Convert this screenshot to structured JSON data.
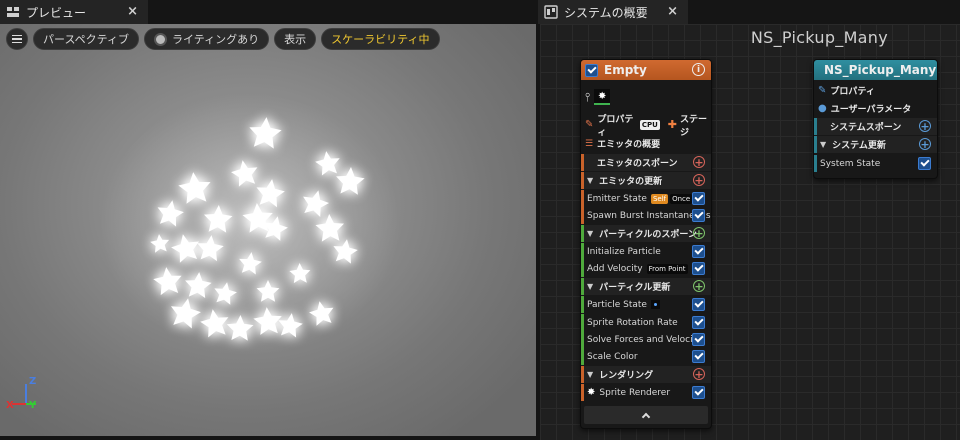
{
  "preview": {
    "tab_label": "プレビュー",
    "tab_close": "×",
    "toolbar": {
      "menu_icon": "hamburger-icon",
      "perspective_label": "パースペクティブ",
      "lighting_label": "ライティングあり",
      "show_label": "表示",
      "scalability_label": "スケーラビリティ中"
    },
    "axis": {
      "z": "Z",
      "x": "X",
      "y": "Y"
    }
  },
  "graph": {
    "tab_label": "システムの概要",
    "tab_close": "×",
    "title": "NS_Pickup_Many",
    "emitter_node": {
      "name": "Empty",
      "info_icon": "info-icon",
      "properties_label": "プロパティ",
      "cpu_label": "CPU",
      "stage_label": "ステージ",
      "emitter_summary_label": "エミッタの概要",
      "emitter_spawn_label": "エミッタのスポーン",
      "emitter_update_label": "エミッタの更新",
      "emitter_state_label": "Emitter State",
      "self_badge": "Self",
      "once_badge": "Once",
      "spawn_burst_label": "Spawn Burst Instantaneous",
      "particle_spawn_label": "パーティクルのスポーン",
      "initialize_particle_label": "Initialize Particle",
      "add_velocity_label": "Add Velocity",
      "from_point_badge": "From Point",
      "particle_update_label": "パーティクル更新",
      "particle_state_label": "Particle State",
      "sprite_rotation_label": "Sprite Rotation Rate",
      "solve_forces_label": "Solve Forces and Velocity",
      "scale_color_label": "Scale Color",
      "rendering_label": "レンダリング",
      "sprite_renderer_label": "Sprite Renderer",
      "collapse_icon": "chevron-up-icon"
    },
    "system_node": {
      "name": "NS_Pickup_Many",
      "properties_label": "プロパティ",
      "user_params_label": "ユーザーパラメータ",
      "system_spawn_label": "システムスポーン",
      "system_update_label": "システム更新",
      "system_state_label": "System State"
    }
  },
  "colors": {
    "emitter_header": "#c9622a",
    "system_header": "#2a7f8f",
    "accent_yellow": "#f0c830",
    "check_blue": "#1d4f8e"
  }
}
